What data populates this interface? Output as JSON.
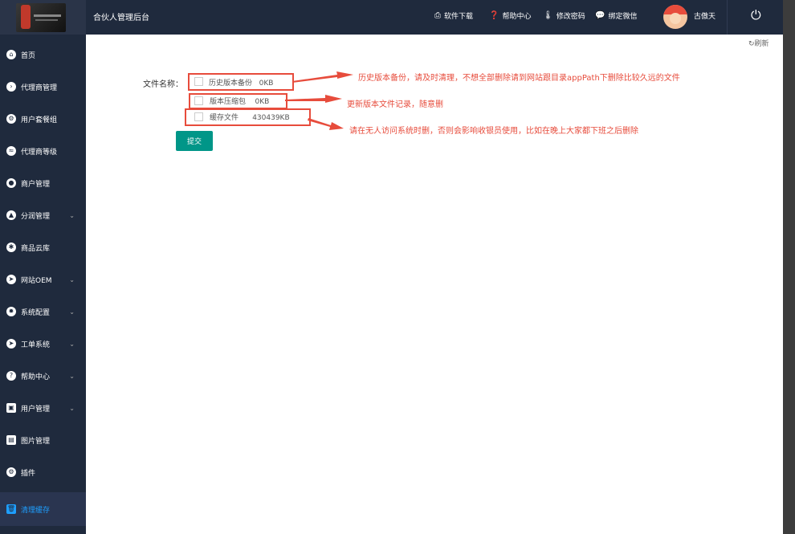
{
  "header": {
    "app_title": "合伙人管理后台",
    "nav": [
      {
        "label": "软件下载",
        "icon": "download-icon"
      },
      {
        "label": "帮助中心",
        "icon": "help-icon"
      },
      {
        "label": "修改密码",
        "icon": "thermometer-icon"
      },
      {
        "label": "绑定微信",
        "icon": "wechat-icon"
      }
    ],
    "username": "古傲天"
  },
  "sidebar": {
    "items": [
      {
        "label": "首页",
        "icon": "home-icon"
      },
      {
        "label": "代理商管理",
        "icon": "agent-icon"
      },
      {
        "label": "用户套餐组",
        "icon": "package-icon"
      },
      {
        "label": "代理商等级",
        "icon": "level-icon"
      },
      {
        "label": "商户管理",
        "icon": "user-icon"
      },
      {
        "label": "分润管理",
        "icon": "profit-icon"
      },
      {
        "label": "商品云库",
        "icon": "star-icon"
      },
      {
        "label": "网站OEM",
        "icon": "send-icon"
      },
      {
        "label": "系统配置",
        "icon": "settings-icon"
      },
      {
        "label": "工单系统",
        "icon": "ticket-icon"
      },
      {
        "label": "帮助中心",
        "icon": "help-icon"
      },
      {
        "label": "用户管理",
        "icon": "user-manage-icon"
      },
      {
        "label": "图片管理",
        "icon": "image-icon"
      },
      {
        "label": "插件",
        "icon": "plugin-icon"
      },
      {
        "label": "清理缓存",
        "icon": "trash-icon"
      }
    ]
  },
  "toolbar": {
    "refresh_label": "刷新"
  },
  "form": {
    "label": "文件名称：",
    "options": [
      {
        "name": "历史版本备份",
        "size": "0KB"
      },
      {
        "name": "版本压缩包",
        "size": "0KB"
      },
      {
        "name": "缓存文件",
        "size": "430439KB"
      }
    ],
    "submit_label": "提交"
  },
  "annotations": [
    "历史版本备份，请及时清理，不想全部删除请到网站跟目录appPath下删除比较久远的文件",
    "更新版本文件记录，随意删",
    "请在无人访问系统时删，否则会影响收银员使用，比如在晚上大家都下班之后删除"
  ],
  "colors": {
    "sidebar_bg": "#1f2a3d",
    "accent": "#009688",
    "annotation": "#e74c3c",
    "active": "#1e9fff"
  }
}
